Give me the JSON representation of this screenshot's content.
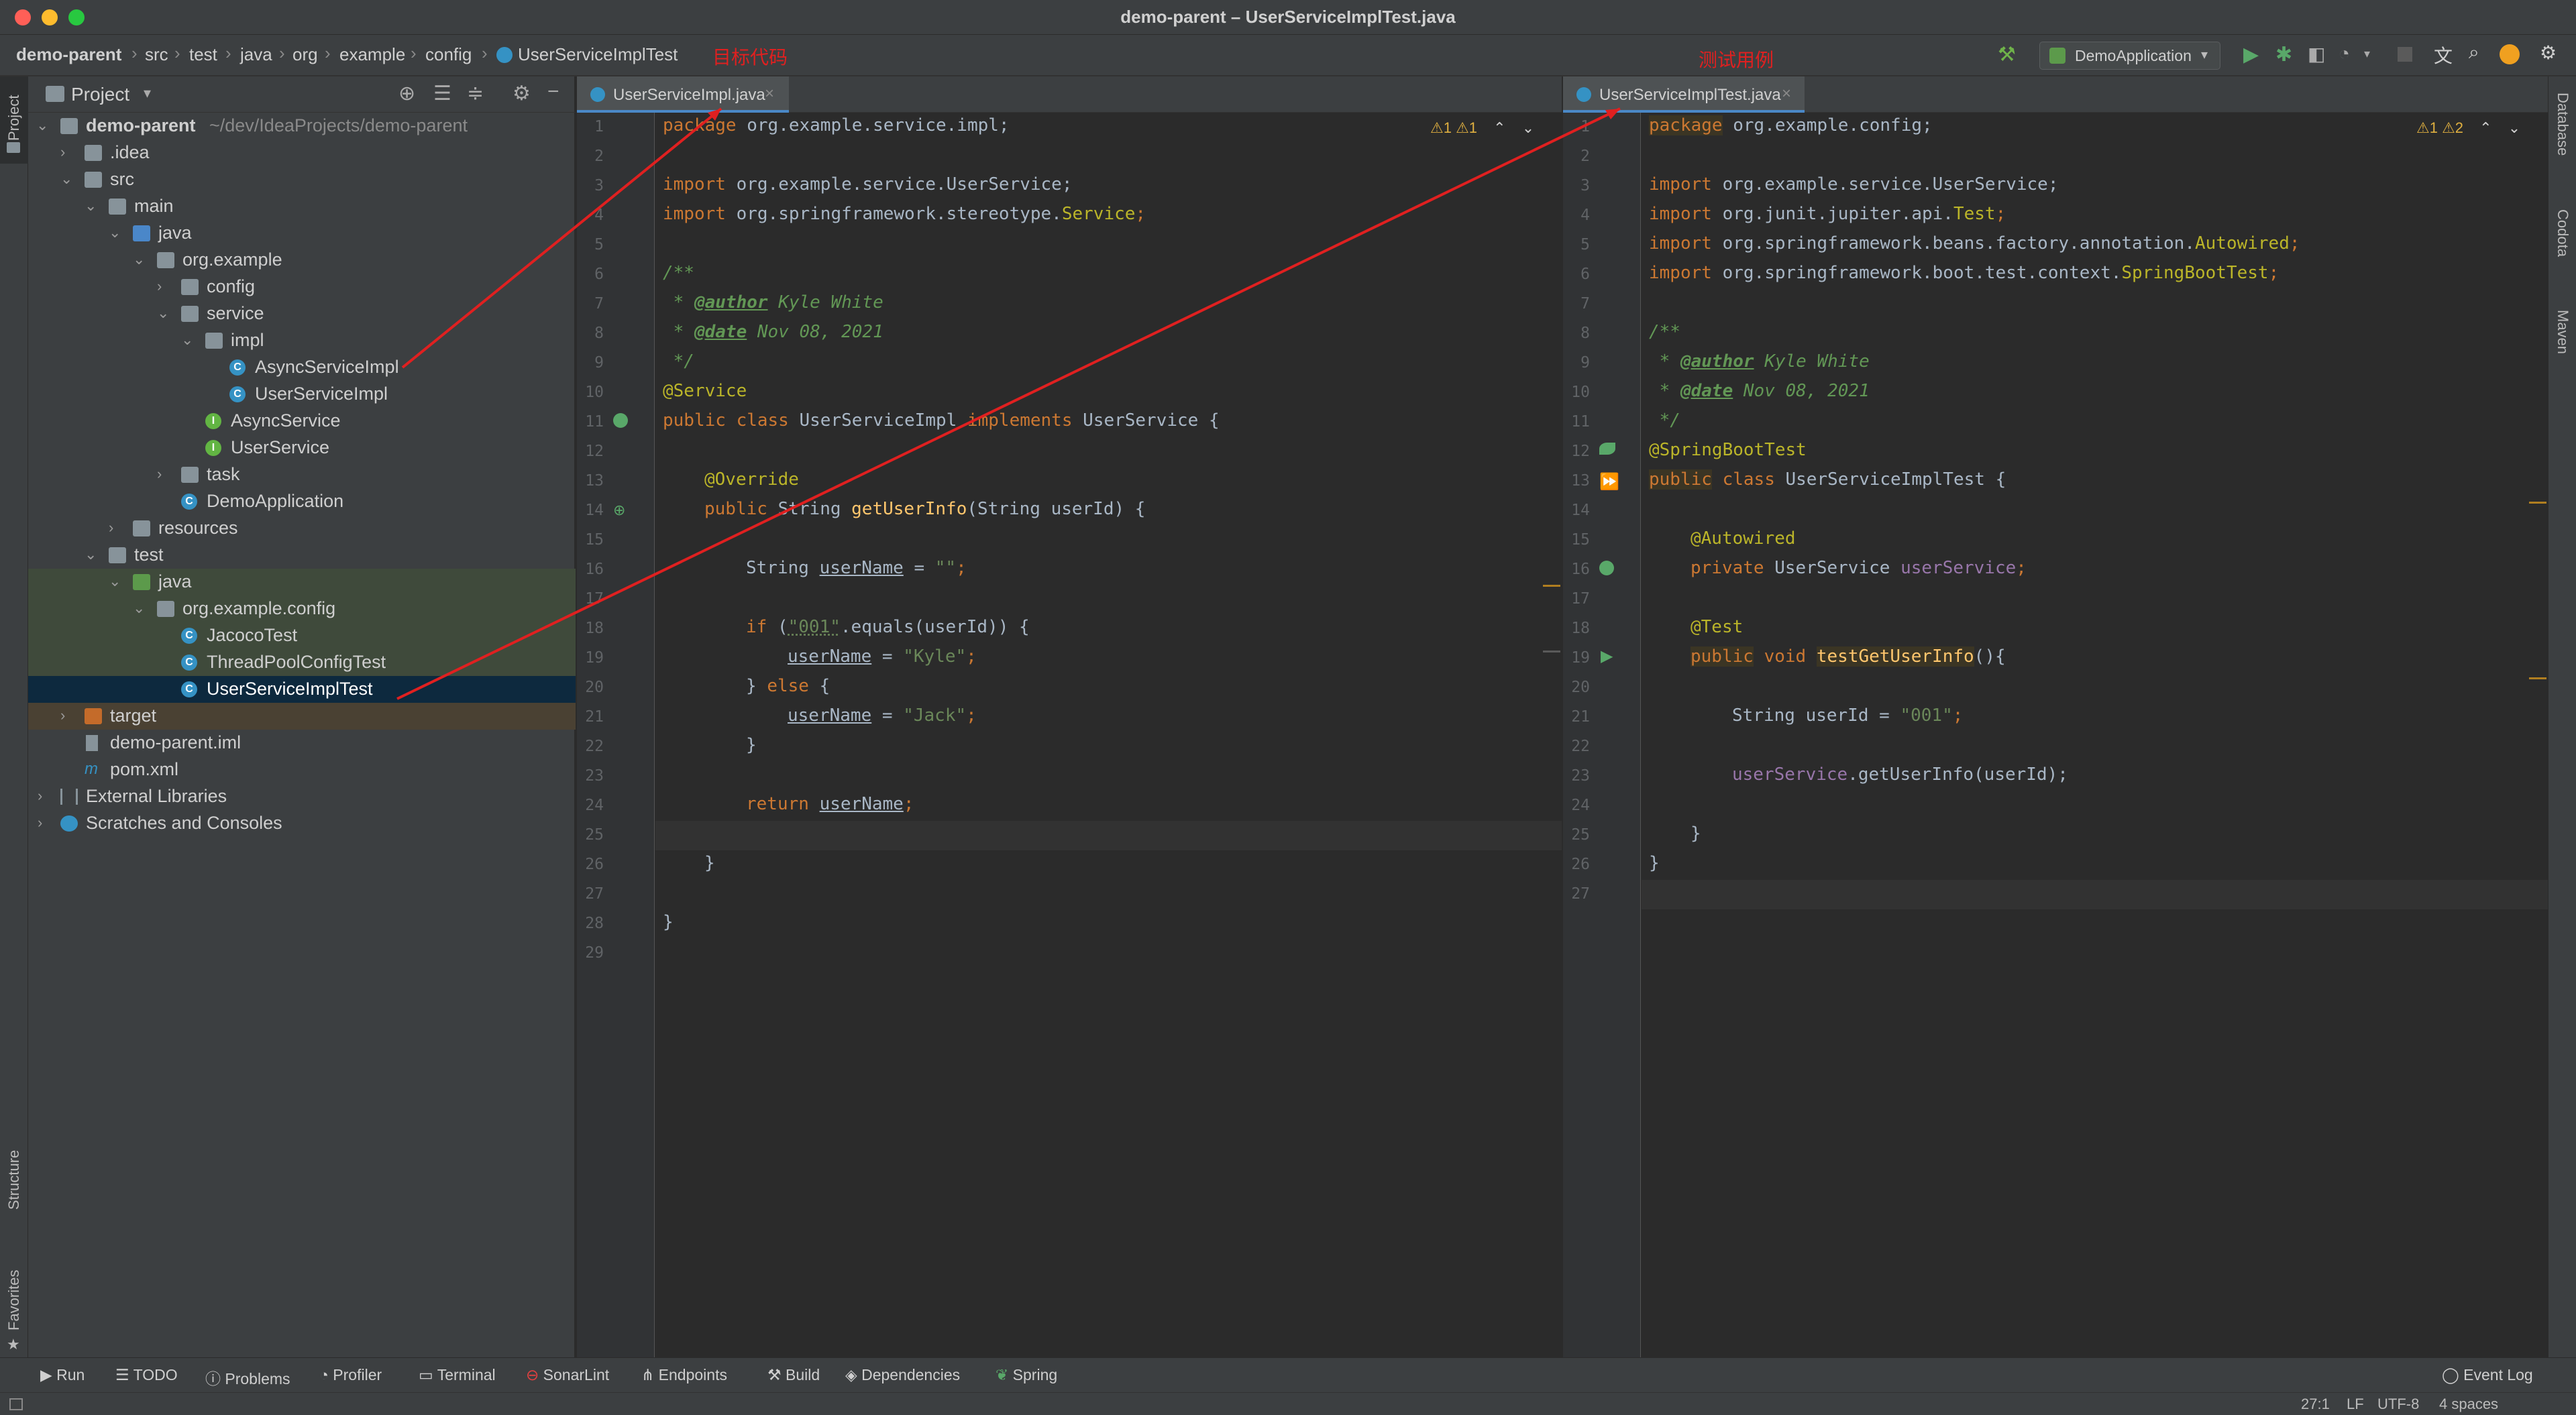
{
  "window": {
    "title": "demo-parent – UserServiceImplTest.java"
  },
  "navbar": {
    "breadcrumbs": [
      "demo-parent",
      "src",
      "test",
      "java",
      "org",
      "example",
      "config",
      "UserServiceImplTest"
    ],
    "run_config": "DemoApplication"
  },
  "annotations": {
    "target_code": "目标代码",
    "test_case": "测试用例"
  },
  "left_strip": {
    "project": "Project",
    "structure": "Structure",
    "favorites": "Favorites"
  },
  "right_strip": {
    "database": "Database",
    "codota": "Codota",
    "maven": "Maven"
  },
  "project_panel": {
    "title": "Project",
    "tree": [
      {
        "label": "demo-parent",
        "suffix": "~/dev/IdeaProjects/demo-parent"
      },
      {
        "label": ".idea"
      },
      {
        "label": "src"
      },
      {
        "label": "main"
      },
      {
        "label": "java"
      },
      {
        "label": "org.example"
      },
      {
        "label": "config"
      },
      {
        "label": "service"
      },
      {
        "label": "impl"
      },
      {
        "label": "AsyncServiceImpl"
      },
      {
        "label": "UserServiceImpl"
      },
      {
        "label": "AsyncService"
      },
      {
        "label": "UserService"
      },
      {
        "label": "task"
      },
      {
        "label": "DemoApplication"
      },
      {
        "label": "resources"
      },
      {
        "label": "test"
      },
      {
        "label": "java"
      },
      {
        "label": "org.example.config"
      },
      {
        "label": "JacocoTest"
      },
      {
        "label": "ThreadPoolConfigTest"
      },
      {
        "label": "UserServiceImplTest"
      },
      {
        "label": "target"
      },
      {
        "label": "demo-parent.iml"
      },
      {
        "label": "pom.xml"
      },
      {
        "label": "External Libraries"
      },
      {
        "label": "Scratches and Consoles"
      }
    ]
  },
  "left_editor": {
    "tab": "UserServiceImpl.java",
    "warnings": "⚠1  ⚠1",
    "lines": [
      "1",
      "2",
      "3",
      "4",
      "5",
      "6",
      "7",
      "8",
      "9",
      "10",
      "11",
      "12",
      "13",
      "14",
      "15",
      "16",
      "17",
      "18",
      "19",
      "20",
      "21",
      "22",
      "23",
      "24",
      "25",
      "26",
      "27",
      "28",
      "29"
    ],
    "code": {
      "l1": "org.example.service.impl;",
      "l3": "org.example.service.UserService;",
      "l4a": "org.springframework.stereotype.",
      "l4b": "Service",
      "l6": "/**",
      "l7a": "@author",
      "l7b": " Kyle White",
      "l8a": "@date",
      "l8b": " Nov 08, 2021",
      "l9": " */",
      "l10": "@Service",
      "l11a": "UserServiceImpl ",
      "l11b": "UserService {",
      "l13": "@Override",
      "l14a": "String ",
      "l14b": "getUserInfo",
      "l14c": "(String userId) {",
      "l16a": "String ",
      "l16b": "userName",
      "l16c": " = ",
      "l16d": "\"\"",
      "l18a": "\"001\"",
      "l18b": ".equals(userId)) {",
      "l19a": "userName",
      "l19b": " = ",
      "l19c": "\"Kyle\"",
      "l20": "} ",
      "l20b": " {",
      "l21a": "userName",
      "l21b": " = ",
      "l21c": "\"Jack\"",
      "l22": "}",
      "l24b": "userName",
      "l26": "}",
      "l28": "}"
    }
  },
  "right_editor": {
    "tab": "UserServiceImplTest.java",
    "warnings": "⚠1  ⚠2",
    "lines": [
      "1",
      "2",
      "3",
      "4",
      "5",
      "6",
      "7",
      "8",
      "9",
      "10",
      "11",
      "12",
      "13",
      "14",
      "15",
      "16",
      "17",
      "18",
      "19",
      "20",
      "21",
      "22",
      "23",
      "24",
      "25",
      "26",
      "27"
    ],
    "code": {
      "l1": "org.example.config;",
      "l3": "org.example.service.UserService;",
      "l4a": "org.junit.jupiter.api.",
      "l4b": "Test",
      "l5a": "org.springframework.beans.factory.annotation.",
      "l5b": "Autowired",
      "l6a": "org.springframework.boot.test.context.",
      "l6b": "SpringBootTest",
      "l8": "/**",
      "l9a": "@author",
      "l9b": " Kyle White",
      "l10a": "@date",
      "l10b": " Nov 08, 2021",
      "l11": " */",
      "l12": "@SpringBootTest",
      "l13a": "UserServiceImplTest {",
      "l15": "@Autowired",
      "l16a": "UserService ",
      "l16b": "userService",
      "l18": "@Test",
      "l19a": "testGetUserInfo",
      "l19b": "(){",
      "l21a": "String userId = ",
      "l21b": "\"001\"",
      "l23a": "userService",
      "l23b": ".getUserInfo(userId);",
      "l25": "}",
      "l26": "}"
    }
  },
  "toolwindows": [
    "Run",
    "TODO",
    "Problems",
    "Profiler",
    "Terminal",
    "SonarLint",
    "Endpoints",
    "Build",
    "Dependencies",
    "Spring"
  ],
  "event_log": "Event Log",
  "status": {
    "position": "27:1",
    "line_sep": "LF",
    "encoding": "UTF-8",
    "indent": "4 spaces"
  },
  "colors": {
    "accent": "#4a88c7",
    "annotation_red": "#e02020",
    "keyword": "#cc7832",
    "string": "#6a8759"
  }
}
